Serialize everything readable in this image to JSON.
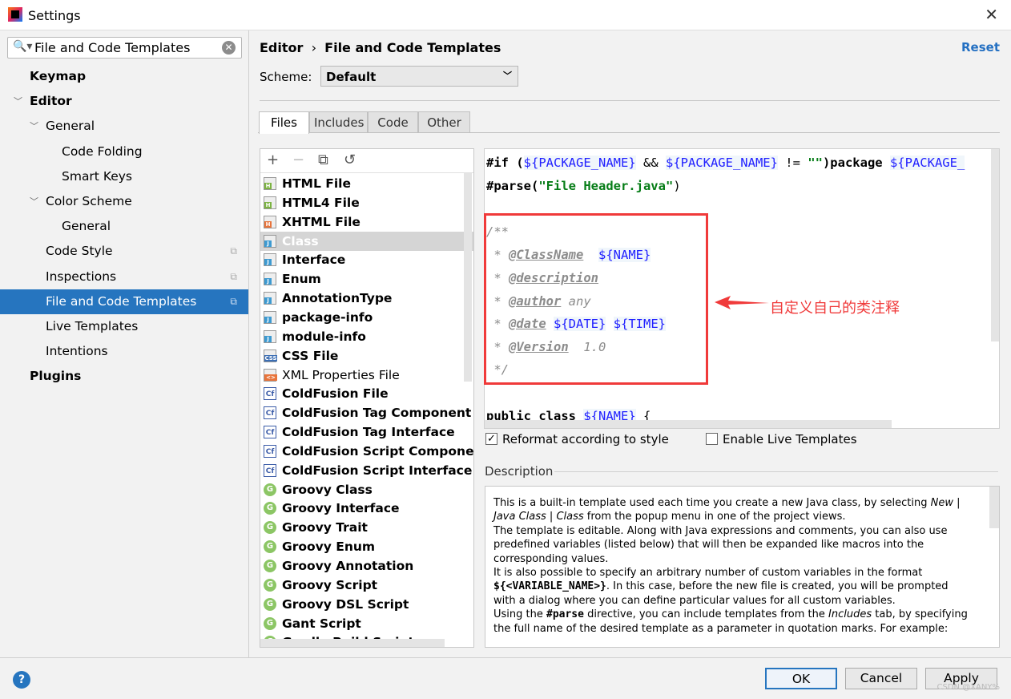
{
  "window": {
    "title": "Settings",
    "close": "✕"
  },
  "search": {
    "value": "File and Code Templates"
  },
  "sidebar": {
    "items": [
      {
        "label": "Keymap",
        "bold": true
      },
      {
        "label": "Editor",
        "bold": true,
        "expanded": true
      },
      {
        "label": "General",
        "expanded": true
      },
      {
        "label": "Code Folding"
      },
      {
        "label": "Smart Keys"
      },
      {
        "label": "Color Scheme",
        "expanded": true
      },
      {
        "label": "General"
      },
      {
        "label": "Code Style",
        "copy": true
      },
      {
        "label": "Inspections",
        "copy": true
      },
      {
        "label": "File and Code Templates",
        "copy": true,
        "selected": true
      },
      {
        "label": "Live Templates"
      },
      {
        "label": "Intentions"
      },
      {
        "label": "Plugins",
        "bold": true
      }
    ]
  },
  "header": {
    "crumb_parent": "Editor",
    "crumb_sep": "›",
    "crumb_current": "File and Code Templates",
    "reset": "Reset"
  },
  "scheme": {
    "label": "Scheme:",
    "value": "Default"
  },
  "tabs": [
    "Files",
    "Includes",
    "Code",
    "Other"
  ],
  "toolbar": {
    "add": "+",
    "remove": "−",
    "copy": "⧉",
    "reset": "↺"
  },
  "templates": [
    {
      "label": "HTML File",
      "icon": "html-file",
      "badge": "H",
      "color": "#7cb342"
    },
    {
      "label": "HTML4 File",
      "icon": "html-file",
      "badge": "H",
      "color": "#7cb342"
    },
    {
      "label": "XHTML File",
      "icon": "html-file",
      "badge": "H",
      "color": "#e8743b"
    },
    {
      "label": "Class",
      "icon": "java-file",
      "badge": "J",
      "color": "#3d9ad1",
      "selected": true
    },
    {
      "label": "Interface",
      "icon": "java-file",
      "badge": "J",
      "color": "#3d9ad1"
    },
    {
      "label": "Enum",
      "icon": "java-file",
      "badge": "J",
      "color": "#3d9ad1"
    },
    {
      "label": "AnnotationType",
      "icon": "java-file",
      "badge": "J",
      "color": "#3d9ad1"
    },
    {
      "label": "package-info",
      "icon": "java-file",
      "badge": "J",
      "color": "#3d9ad1"
    },
    {
      "label": "module-info",
      "icon": "java-file",
      "badge": "J",
      "color": "#3d9ad1"
    },
    {
      "label": "CSS File",
      "icon": "css-file",
      "badge": "CSS",
      "color": "#3d6fb4"
    },
    {
      "label": "XML Properties File",
      "icon": "xml-file",
      "badge": "<>",
      "color": "#e8743b",
      "plain": true
    },
    {
      "label": "ColdFusion File",
      "icon": "coldfusion",
      "badge": "Cf"
    },
    {
      "label": "ColdFusion Tag Component",
      "icon": "coldfusion",
      "badge": "Cf"
    },
    {
      "label": "ColdFusion Tag Interface",
      "icon": "coldfusion",
      "badge": "Cf"
    },
    {
      "label": "ColdFusion Script Component",
      "icon": "coldfusion",
      "badge": "Cf"
    },
    {
      "label": "ColdFusion Script Interface",
      "icon": "coldfusion",
      "badge": "Cf"
    },
    {
      "label": "Groovy Class",
      "icon": "groovy",
      "badge": "G"
    },
    {
      "label": "Groovy Interface",
      "icon": "groovy",
      "badge": "G"
    },
    {
      "label": "Groovy Trait",
      "icon": "groovy",
      "badge": "G"
    },
    {
      "label": "Groovy Enum",
      "icon": "groovy",
      "badge": "G"
    },
    {
      "label": "Groovy Annotation",
      "icon": "groovy",
      "badge": "G"
    },
    {
      "label": "Groovy Script",
      "icon": "groovy",
      "badge": "G"
    },
    {
      "label": "Groovy DSL Script",
      "icon": "groovy",
      "badge": "G"
    },
    {
      "label": "Gant Script",
      "icon": "groovy",
      "badge": "G"
    },
    {
      "label": "Gradle Build Script",
      "icon": "groovy",
      "badge": "G"
    }
  ],
  "code": {
    "l1a": "#if (",
    "l1v1": "${PACKAGE_NAME}",
    "l1b": " && ",
    "l1v2": "${PACKAGE_NAME}",
    "l1c": " != ",
    "l1s": "\"\"",
    "l1d": ")package ",
    "l1v3": "${PACKAGE_",
    "l2a": "#parse(",
    "l2s": "\"File Header.java\"",
    "l2b": ")",
    "c1": "/**",
    "c2star": " * ",
    "c2tag": "@ClassName",
    "c2v": "${NAME}",
    "c3tag": "@description",
    "c4tag": "@author",
    "c4v": " any",
    "c5tag": "@date",
    "c5v1": "${DATE}",
    "c5v2": "${TIME}",
    "c6tag": "@Version",
    "c6v": "  1.0",
    "c7": " */",
    "l10a": "public class ",
    "l10v": "${NAME}",
    "l10b": " {"
  },
  "annotation": "自定义自己的类注释",
  "options": {
    "reformat": "Reformat according to style",
    "reformat_checked": true,
    "live": "Enable Live Templates",
    "live_checked": false
  },
  "description": {
    "label": "Description",
    "p1a": "This is a built-in template used each time you create a new Java class, by selecting ",
    "p1i": "New | Java Class | Class",
    "p1b": " from the popup menu in one of the project views.",
    "p2": "The template is editable. Along with Java expressions and comments, you can also use predefined variables (listed below) that will then be expanded like macros into the corresponding values.",
    "p3a": "It is also possible to specify an arbitrary number of custom variables in the format ",
    "p3b": "${<VARIABLE_NAME>}",
    "p3c": ". In this case, before the new file is created, you will be prompted with a dialog where you can define particular values for all custom variables.",
    "p4a": "Using the ",
    "p4b": "#parse",
    "p4c": " directive, you can include templates from the ",
    "p4i": "Includes",
    "p4d": " tab, by specifying the full name of the desired template as a parameter in quotation marks. For example:"
  },
  "buttons": {
    "help": "?",
    "ok": "OK",
    "cancel": "Cancel",
    "apply": "Apply"
  },
  "watermark": "CSDN @XANY%"
}
